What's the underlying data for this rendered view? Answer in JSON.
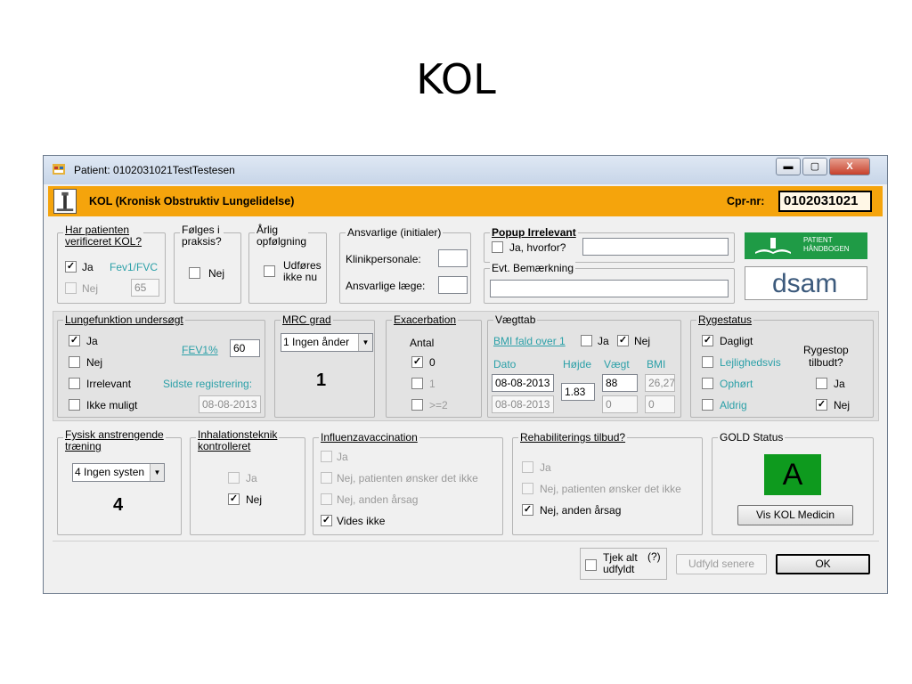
{
  "slide": {
    "title": "KOL"
  },
  "window": {
    "title": "Patient: 0102031021TestTestesen",
    "min": "▬",
    "max": "▢",
    "close": "X"
  },
  "header": {
    "title": "KOL (Kronisk Obstruktiv Lungelidelse)",
    "cpr_label": "Cpr-nr:",
    "cpr_value": "0102031021"
  },
  "verify": {
    "legend_1": "Har patienten",
    "legend_2": "verificeret KOL?",
    "ja": "Ja",
    "ja_checked": true,
    "fev": "Fev1/FVC",
    "nej": "Nej",
    "value": "65"
  },
  "praksis": {
    "legend_1": "Følges i",
    "legend_2": "praksis?",
    "nej": "Nej"
  },
  "aarlig": {
    "legend_1": "Årlig",
    "legend_2": "opfølgning",
    "opt_1": "Udføres",
    "opt_2": "ikke nu"
  },
  "ansvarlige": {
    "legend": "Ansvarlige (initialer)",
    "klinik": "Klinikpersonale:",
    "laege": "Ansvarlige læge:"
  },
  "popup": {
    "legend": "Popup Irrelevant",
    "ja": "Ja, hvorfor?",
    "bem_legend": "Evt. Bemærkning"
  },
  "logos": {
    "ph_1": "PATIENT",
    "ph_2": "HÅNDBOGEN",
    "dsam": "dsam"
  },
  "lunge": {
    "legend": "Lungefunktion undersøgt",
    "ja": "Ja",
    "nej": "Nej",
    "irrelevant": "Irrelevant",
    "ikke": "Ikke muligt",
    "fev_label": "FEV1%",
    "fev_value": "60",
    "sidste": "Sidste registrering:",
    "sidste_dato": "08-08-2013"
  },
  "mrc": {
    "legend": "MRC grad",
    "selected": "1 Ingen ånder",
    "value": "1"
  },
  "exac": {
    "legend": "Exacerbation",
    "antal": "Antal",
    "o0": "0",
    "o1": "1",
    "o2": ">=2"
  },
  "vaegt": {
    "legend": "Vægttab",
    "bmi_fald": "BMI fald over 1",
    "ja": "Ja",
    "nej": "Nej",
    "dato": "Dato",
    "hoejde": "Højde",
    "vaegt": "Vægt",
    "bmi": "BMI",
    "dato_1": "08-08-2013",
    "hoejde_v": "1.83",
    "vaegt_1": "88",
    "bmi_1": "26,27",
    "dato_2": "08-08-2013",
    "vaegt_2": "0",
    "bmi_2": "0"
  },
  "ryg": {
    "legend": "Rygestatus",
    "dagligt": "Dagligt",
    "lejl": "Lejlighedsvis",
    "ophoert": "Ophørt",
    "aldrig": "Aldrig",
    "stop_1": "Rygestop",
    "stop_2": "tilbudt?",
    "ja": "Ja",
    "nej": "Nej"
  },
  "fysisk": {
    "legend_1": "Fysisk anstrengende",
    "legend_2": "træning",
    "selected": "4 Ingen systen",
    "value": "4"
  },
  "inhal": {
    "legend_1": "Inhalationsteknik",
    "legend_2": "kontrolleret",
    "ja": "Ja",
    "nej": "Nej"
  },
  "influ": {
    "legend": "Influenzavaccination",
    "ja": "Ja",
    "nej_pt": "Nej, patienten ønsker det ikke",
    "nej_anden": "Nej, anden årsag",
    "vides": "Vides ikke"
  },
  "rehab": {
    "legend": "Rehabiliterings tilbud?",
    "ja": "Ja",
    "nej_pt": "Nej, patienten ønsker det ikke",
    "nej_anden": "Nej, anden årsag"
  },
  "gold": {
    "legend": "GOLD Status",
    "value": "A",
    "color": "#0e9a1e",
    "button": "Vis KOL Medicin"
  },
  "footer": {
    "tjek_1": "Tjek alt",
    "tjek_2": "udfyldt",
    "help": "(?)",
    "later": "Udfyld senere",
    "ok": "OK"
  }
}
